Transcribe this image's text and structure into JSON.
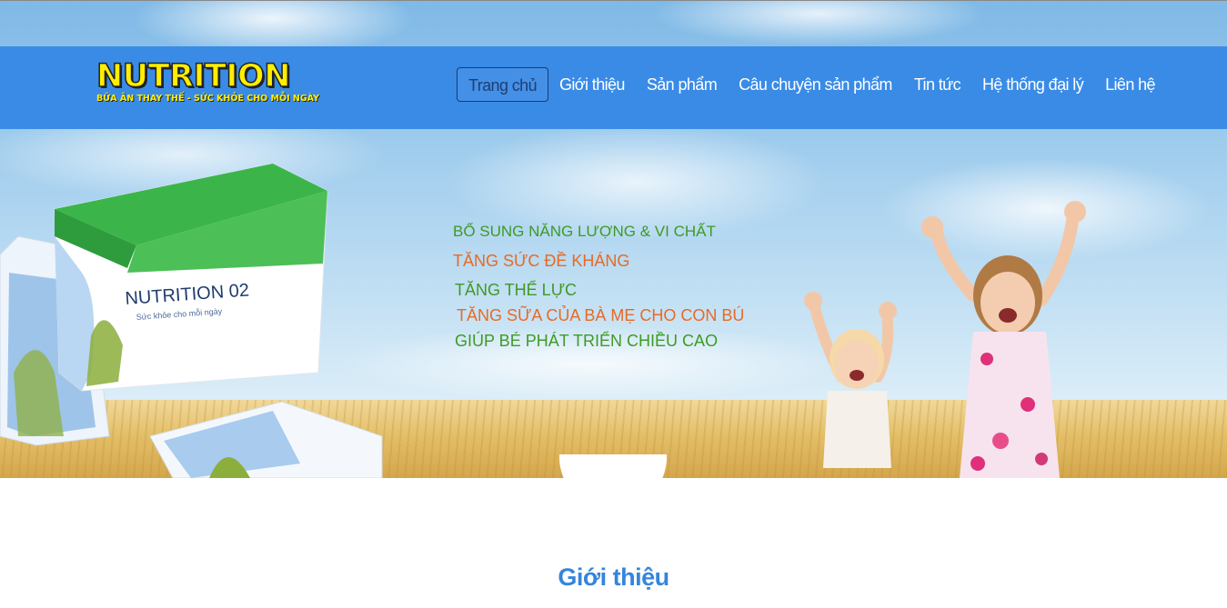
{
  "brand": {
    "title": "NUTRITION",
    "subtitle": "BỮA ĂN THAY THẾ - SỨC KHỎE CHO MỖI NGÀY"
  },
  "nav": {
    "items": [
      {
        "label": "Trang chủ",
        "active": true
      },
      {
        "label": "Giới thiệu",
        "active": false
      },
      {
        "label": "Sản phẩm",
        "active": false
      },
      {
        "label": "Câu chuyện sản phẩm",
        "active": false
      },
      {
        "label": "Tin tức",
        "active": false
      },
      {
        "label": "Hệ thống đại lý",
        "active": false
      },
      {
        "label": "Liên hệ",
        "active": false
      }
    ]
  },
  "hero": {
    "product": {
      "box_name": "NUTRITION 02",
      "box_tagline": "Sức khỏe cho mỗi ngày"
    },
    "taglines": [
      {
        "text": "BỔ SUNG NĂNG LƯỢNG & VI CHẤT",
        "color": "#3f9a25"
      },
      {
        "text": "TĂNG SỨC ĐỀ KHÁNG",
        "color": "#e76a26"
      },
      {
        "text": "TĂNG THỂ LỰC",
        "color": "#3f9a25"
      },
      {
        "text": "TĂNG SỮA CỦA BÀ MẸ CHO CON BÚ",
        "color": "#e76a26"
      },
      {
        "text": "GIÚP BÉ PHÁT TRIỂN CHIỀU CAO",
        "color": "#3f9a25"
      }
    ],
    "controls": {
      "prev_icon": "chevron-left-icon",
      "next_icon": "chevron-right-icon",
      "prev_glyph": "‹",
      "next_glyph": "›"
    }
  },
  "section": {
    "title": "Giới thiệu"
  },
  "colors": {
    "header": "#3a8be6",
    "logo": "#ffee00",
    "section_title": "#3585dc",
    "green": "#3f9a25",
    "orange": "#e76a26"
  }
}
